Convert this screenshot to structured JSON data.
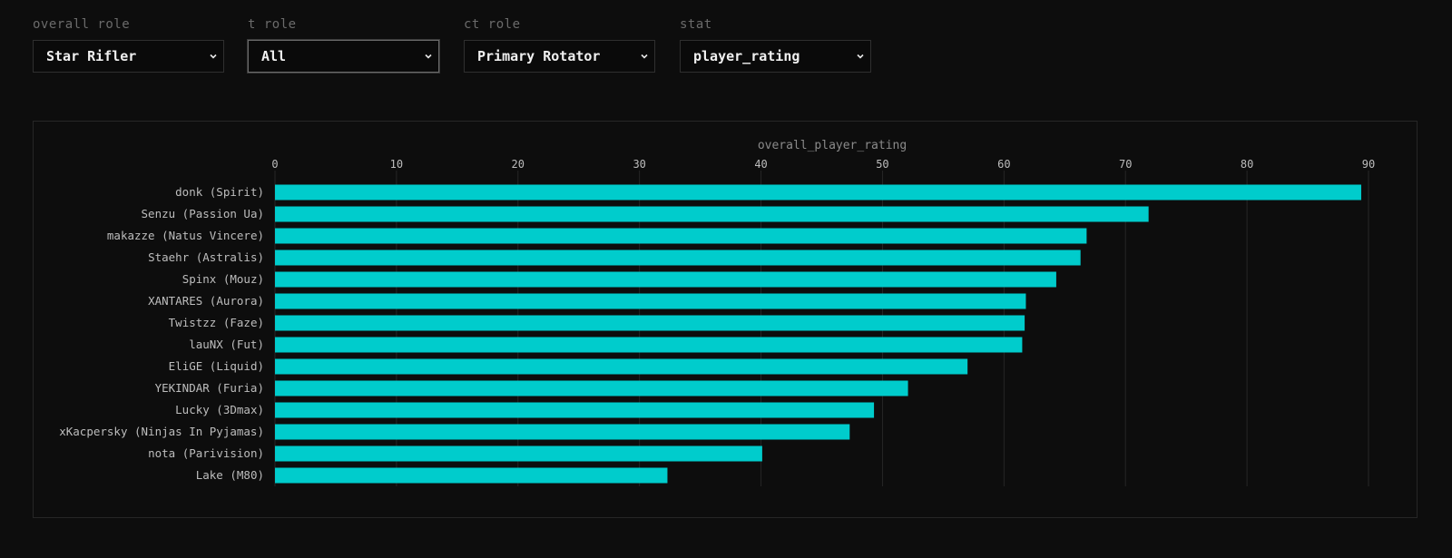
{
  "filters": [
    {
      "label": "overall role",
      "value": "Star Rifler"
    },
    {
      "label": "t role",
      "value": "All"
    },
    {
      "label": "ct role",
      "value": "Primary Rotator"
    },
    {
      "label": "stat",
      "value": "player_rating"
    }
  ],
  "colors": {
    "bar": "#00cccc",
    "background": "#0d0d0d",
    "grid": "#262626",
    "label": "#bdbdbd",
    "axis_title": "#8a8a8a"
  },
  "chart_data": {
    "type": "bar",
    "orientation": "horizontal",
    "xlabel": "overall_player_rating",
    "xlabel_position": "top",
    "ylabel": "",
    "xlim": [
      0,
      90
    ],
    "xticks": [
      0,
      10,
      20,
      30,
      40,
      50,
      60,
      70,
      80,
      90
    ],
    "grid": true,
    "categories": [
      "donk (Spirit)",
      "Senzu (Passion Ua)",
      "makazze (Natus Vincere)",
      "Staehr (Astralis)",
      "Spinx (Mouz)",
      "XANTARES (Aurora)",
      "Twistzz (Faze)",
      "lauNX (Fut)",
      "EliGE (Liquid)",
      "YEKINDAR (Furia)",
      "Lucky (3Dmax)",
      "xKacpersky (Ninjas In Pyjamas)",
      "nota (Parivision)",
      "Lake (M80)"
    ],
    "values": [
      89.4,
      71.9,
      66.8,
      66.3,
      64.3,
      61.8,
      61.7,
      61.5,
      57.0,
      52.1,
      49.3,
      47.3,
      40.1,
      32.3
    ]
  }
}
